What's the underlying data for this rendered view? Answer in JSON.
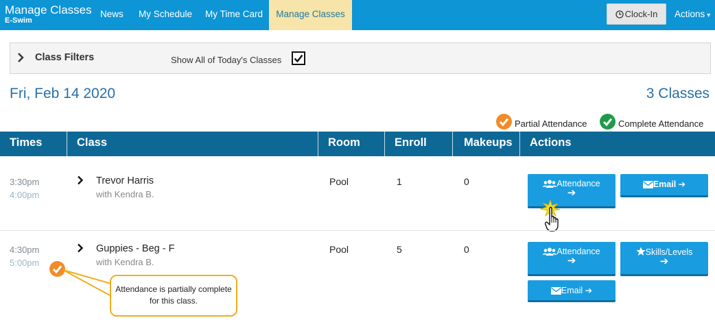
{
  "brand": {
    "title": "Manage Classes",
    "subtitle": "E-Swim"
  },
  "nav": {
    "items": [
      {
        "label": "News"
      },
      {
        "label": "My Schedule"
      },
      {
        "label": "My Time Card"
      },
      {
        "label": "Manage Classes",
        "active": true
      }
    ],
    "clock_in_label": "Clock-In",
    "actions_label": "Actions"
  },
  "filters": {
    "title": "Class Filters",
    "show_all_label": "Show All of Today's Classes",
    "show_all_checked": true
  },
  "date_header": {
    "date": "Fri, Feb 14 2020",
    "count": "3 Classes"
  },
  "legend": {
    "partial": "Partial Attendance",
    "complete": "Complete Attendance"
  },
  "table": {
    "headers": [
      "Times",
      "Class",
      "Room",
      "Enroll",
      "Makeups",
      "Actions"
    ],
    "rows": [
      {
        "start": "3:30pm",
        "end": "4:00pm",
        "class_name": "Trevor Harris",
        "with": "with Kendra B.",
        "room": "Pool",
        "enroll": "1",
        "makeups": "0",
        "attendance_label": "Attendance",
        "email_label": "Email"
      },
      {
        "start": "4:30pm",
        "end": "5:00pm",
        "class_name": "Guppies - Beg - F",
        "with": "with Kendra B.",
        "room": "Pool",
        "enroll": "5",
        "makeups": "0",
        "attendance_label": "Attendance",
        "skills_label": "Skills/Levels",
        "email_label": "Email",
        "status": "partial"
      }
    ]
  },
  "callout": {
    "text": "Attendance is partially complete for this class."
  },
  "colors": {
    "nav_bg": "#0d95d6",
    "nav_active": "#f7e4a8",
    "table_header": "#0e6896",
    "button": "#1a9de0",
    "partial": "#f28c28",
    "complete": "#1e9b4a",
    "callout_border": "#f0ad1e"
  }
}
